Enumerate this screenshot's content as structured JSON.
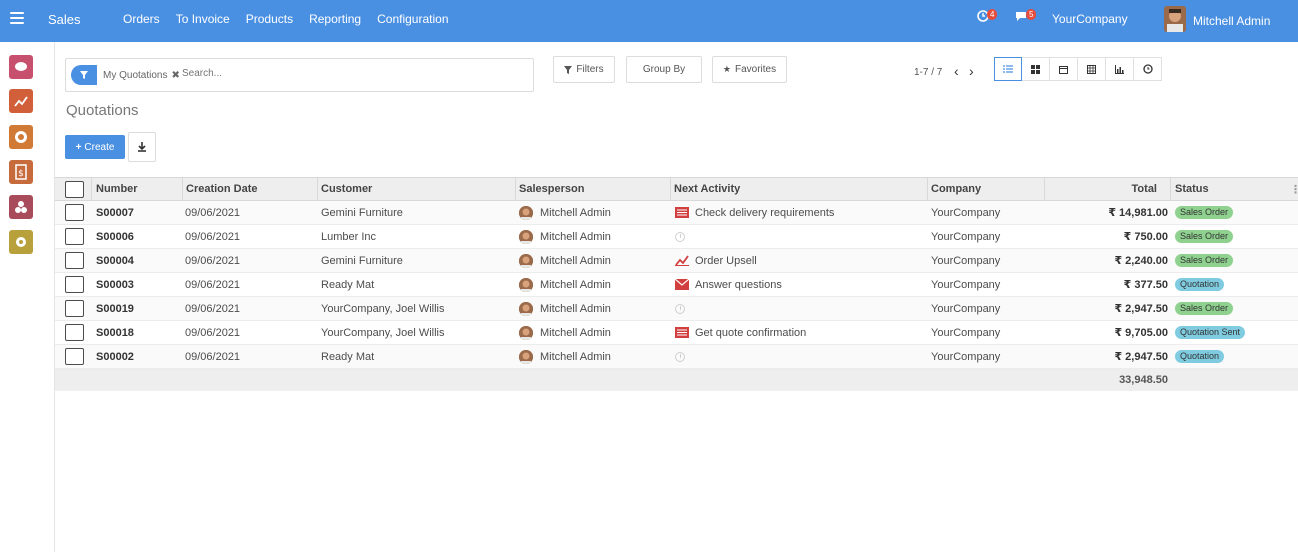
{
  "topbar": {
    "brand": "Sales",
    "nav": [
      "Orders",
      "To Invoice",
      "Products",
      "Reporting",
      "Configuration"
    ],
    "activity_count": "4",
    "messages_count": "5",
    "company": "YourCompany",
    "user": "Mitchell Admin"
  },
  "sidebar": {
    "apps": [
      {
        "icon": "discuss-icon",
        "color": "#c7506e"
      },
      {
        "icon": "chart-icon",
        "color": "#d05f3a"
      },
      {
        "icon": "website-icon",
        "color": "#d07a36"
      },
      {
        "icon": "invoice-icon",
        "color": "#c76b3d"
      },
      {
        "icon": "apps-icon",
        "color": "#a84b5a"
      },
      {
        "icon": "settings-icon",
        "color": "#b8a03a"
      }
    ]
  },
  "search": {
    "facet": "My Quotations",
    "placeholder": "Search..."
  },
  "control": {
    "filters": "Filters",
    "group_by": "Group By",
    "favorites": "Favorites",
    "pager": "1-7 / 7",
    "title": "Quotations",
    "create": "Create"
  },
  "table": {
    "headers": [
      "Number",
      "Creation Date",
      "Customer",
      "Salesperson",
      "Next Activity",
      "Company",
      "Total",
      "Status"
    ],
    "rows": [
      {
        "number": "S00007",
        "date": "09/06/2021",
        "customer": "Gemini Furniture",
        "salesperson": "Mitchell Admin",
        "activity": "Check delivery requirements",
        "activity_icon": "tasks-icon",
        "company": "YourCompany",
        "total": "₹ 14,981.00",
        "status": "Sales Order",
        "status_color": "#8fd18f"
      },
      {
        "number": "S00006",
        "date": "09/06/2021",
        "customer": "Lumber Inc",
        "salesperson": "Mitchell Admin",
        "activity": "",
        "activity_icon": "clock-icon",
        "company": "YourCompany",
        "total": "₹ 750.00",
        "status": "Sales Order",
        "status_color": "#8fd18f"
      },
      {
        "number": "S00004",
        "date": "09/06/2021",
        "customer": "Gemini Furniture",
        "salesperson": "Mitchell Admin",
        "activity": "Order Upsell",
        "activity_icon": "trend-icon",
        "company": "YourCompany",
        "total": "₹ 2,240.00",
        "status": "Sales Order",
        "status_color": "#8fd18f"
      },
      {
        "number": "S00003",
        "date": "09/06/2021",
        "customer": "Ready Mat",
        "salesperson": "Mitchell Admin",
        "activity": "Answer questions",
        "activity_icon": "envelope-icon",
        "company": "YourCompany",
        "total": "₹ 377.50",
        "status": "Quotation",
        "status_color": "#7fcbe0"
      },
      {
        "number": "S00019",
        "date": "09/06/2021",
        "customer": "YourCompany, Joel Willis",
        "salesperson": "Mitchell Admin",
        "activity": "",
        "activity_icon": "clock-icon",
        "company": "YourCompany",
        "total": "₹ 2,947.50",
        "status": "Sales Order",
        "status_color": "#8fd18f"
      },
      {
        "number": "S00018",
        "date": "09/06/2021",
        "customer": "YourCompany, Joel Willis",
        "salesperson": "Mitchell Admin",
        "activity": "Get quote confirmation",
        "activity_icon": "tasks-icon",
        "company": "YourCompany",
        "total": "₹ 9,705.00",
        "status": "Quotation Sent",
        "status_color": "#7fcbe0"
      },
      {
        "number": "S00002",
        "date": "09/06/2021",
        "customer": "Ready Mat",
        "salesperson": "Mitchell Admin",
        "activity": "",
        "activity_icon": "clock-icon",
        "company": "YourCompany",
        "total": "₹ 2,947.50",
        "status": "Quotation",
        "status_color": "#7fcbe0"
      }
    ],
    "grand_total": "33,948.50"
  }
}
